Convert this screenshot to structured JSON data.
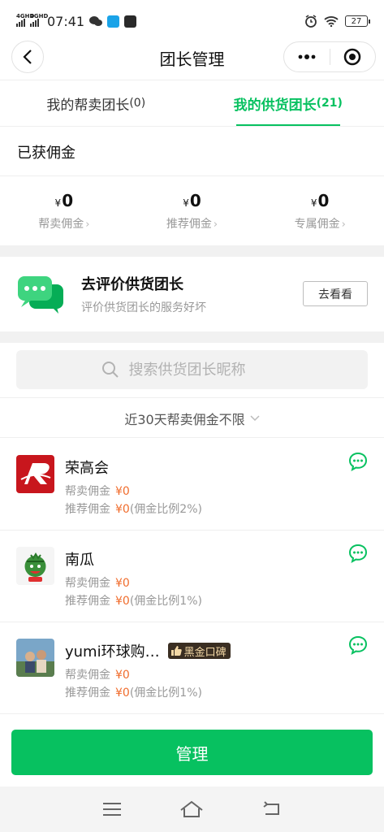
{
  "status_bar": {
    "net1": "4GHD",
    "net2": "4GHD",
    "time": "07:41",
    "battery": "27"
  },
  "nav": {
    "title": "团长管理"
  },
  "tabs": [
    {
      "label": "我的帮卖团长",
      "count": "(0)"
    },
    {
      "label": "我的供货团长",
      "count": "(21)"
    }
  ],
  "commission": {
    "title": "已获佣金",
    "currency": "¥",
    "stats": [
      {
        "value": "0",
        "label": "帮卖佣金"
      },
      {
        "value": "0",
        "label": "推荐佣金"
      },
      {
        "value": "0",
        "label": "专属佣金"
      }
    ]
  },
  "review": {
    "title": "去评价供货团长",
    "subtitle": "评价供货团长的服务好坏",
    "button": "去看看"
  },
  "search": {
    "placeholder": "搜索供货团长昵称"
  },
  "filter": {
    "label": "近30天帮卖佣金不限"
  },
  "leaders": [
    {
      "name": "荣高会",
      "line1_label": "帮卖佣金",
      "line1_value": "¥0",
      "line2_label": "推荐佣金",
      "line2_value": "¥0",
      "line2_note": "(佣金比例2%)",
      "badge": ""
    },
    {
      "name": "南瓜",
      "line1_label": "帮卖佣金",
      "line1_value": "¥0",
      "line2_label": "推荐佣金",
      "line2_value": "¥0",
      "line2_note": "(佣金比例1%)",
      "badge": ""
    },
    {
      "name": "yumi环球购…",
      "line1_label": "帮卖佣金",
      "line1_value": "¥0",
      "line2_label": "推荐佣金",
      "line2_value": "¥0",
      "line2_note": "(佣金比例1%)",
      "badge": "黑金口碑"
    }
  ],
  "manage_button": "管理",
  "colors": {
    "accent": "#07c160",
    "amount": "#f06c2c"
  }
}
